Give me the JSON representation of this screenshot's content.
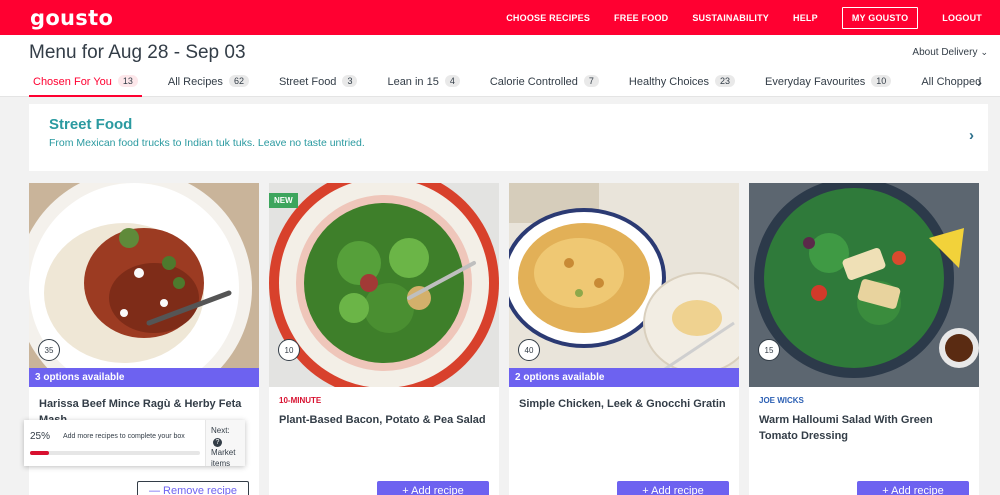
{
  "nav": {
    "logo": "gousto",
    "links": [
      "CHOOSE RECIPES",
      "FREE FOOD",
      "SUSTAINABILITY",
      "HELP",
      "MY GOUSTO",
      "LOGOUT"
    ]
  },
  "header": {
    "menu_title": "Menu for Aug 28 - Sep 03",
    "about_delivery": "About Delivery"
  },
  "tabs": [
    {
      "label": "Chosen For You",
      "count": "13"
    },
    {
      "label": "All Recipes",
      "count": "62"
    },
    {
      "label": "Street Food",
      "count": "3"
    },
    {
      "label": "Lean in 15",
      "count": "4"
    },
    {
      "label": "Calorie Controlled",
      "count": "7"
    },
    {
      "label": "Healthy Choices",
      "count": "23"
    },
    {
      "label": "Everyday Favourites",
      "count": "10"
    },
    {
      "label": "All Chopped",
      "count": ""
    }
  ],
  "banner": {
    "title": "Street Food",
    "subtitle": "From Mexican food trucks to Indian tuk tuks. Leave no taste untried."
  },
  "cards": [
    {
      "title": "Harissa Beef Mince Ragù & Herby Feta Mash",
      "time": "35",
      "options": "3 options available",
      "tag": "",
      "badge": "",
      "button": "Remove recipe"
    },
    {
      "title": "Plant-Based Bacon, Potato & Pea Salad",
      "time": "10",
      "options": "",
      "tag": "10-MINUTE",
      "badge": "NEW",
      "button": "Add recipe"
    },
    {
      "title": "Simple Chicken, Leek & Gnocchi Gratin",
      "time": "40",
      "options": "2 options available",
      "tag": "",
      "badge": "",
      "button": "Add recipe"
    },
    {
      "title": "Warm Halloumi Salad With Green Tomato Dressing",
      "time": "15",
      "options": "",
      "tag": "JOE WICKS",
      "badge": "",
      "button": "Add recipe"
    }
  ],
  "progress": {
    "percent": "25%",
    "fraction": 0.25,
    "message": "Add more recipes to complete your box",
    "next_label": "Next:",
    "next_text": "Market items"
  },
  "colors": {
    "brand": "#ff0031",
    "accent": "#6d62f0",
    "teal": "#2a9aa0",
    "tag_10min": "#d8102f",
    "tag_joe": "#2b5fb3"
  }
}
